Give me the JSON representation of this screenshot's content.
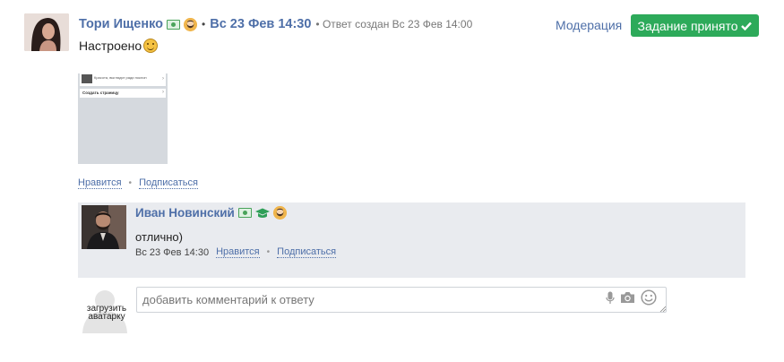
{
  "answer": {
    "author": "Тори Ищенко",
    "separator": "•",
    "date": "Вс 23 Фев 14:30",
    "edited": "• Ответ создан Вс 23 Фев 14:00",
    "moderation_label": "Модерация",
    "accepted_label": "Задание принято",
    "text": "Настроено",
    "actions": {
      "like": "Нравится",
      "bullet": "•",
      "subscribe": "Подписаться"
    }
  },
  "comment": {
    "author": "Иван Новинский",
    "text": "отлично)",
    "date": "Вс 23 Фев 14:30",
    "like": "Нравится",
    "bullet": "•",
    "subscribe": "Подписаться"
  },
  "new_comment": {
    "upload_avatar_label": "загрузить аватарку",
    "placeholder": "добавить комментарий к ответу"
  },
  "thumbnail": {
    "row1_text": "Красота, выглядят ради поклон",
    "row2_text": "Создать страницу"
  },
  "icons": [
    "money-badge-icon",
    "beard-avatar-icon",
    "graduation-cap-icon",
    "checkmark-icon",
    "smile-emoji-icon",
    "microphone-icon",
    "camera-icon",
    "emoji-icon",
    "resize-grip-icon",
    "user-placeholder-icon"
  ],
  "colors": {
    "link": "#4e6fa8",
    "accept_button": "#2daa5a",
    "comment_background": "#e9ebef"
  }
}
